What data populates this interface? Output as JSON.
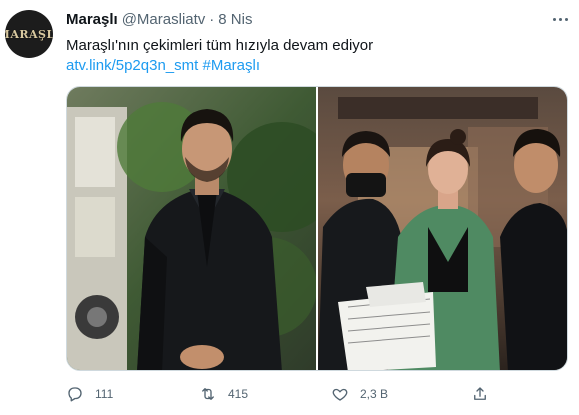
{
  "tweet": {
    "avatar_text": "MARAŞLI",
    "name": "Maraşlı",
    "handle": "@Marasliatv",
    "separator": "·",
    "time": "8 Nis",
    "text_line1": "Maraşlı'nın çekimleri tüm hızıyla devam ediyor",
    "link": "atv.link/5p2q3n_smt",
    "hashtag": "#Maraşlı",
    "media": [
      "photo",
      "photo"
    ]
  },
  "actions": {
    "reply": {
      "icon": "reply-icon",
      "count": "111"
    },
    "retweet": {
      "icon": "retweet-icon",
      "count": "415"
    },
    "like": {
      "icon": "like-icon",
      "count": "2,3 B"
    },
    "share": {
      "icon": "share-icon"
    }
  },
  "colors": {
    "link": "#1d9bf0",
    "muted": "#536471",
    "text": "#0f1419"
  }
}
